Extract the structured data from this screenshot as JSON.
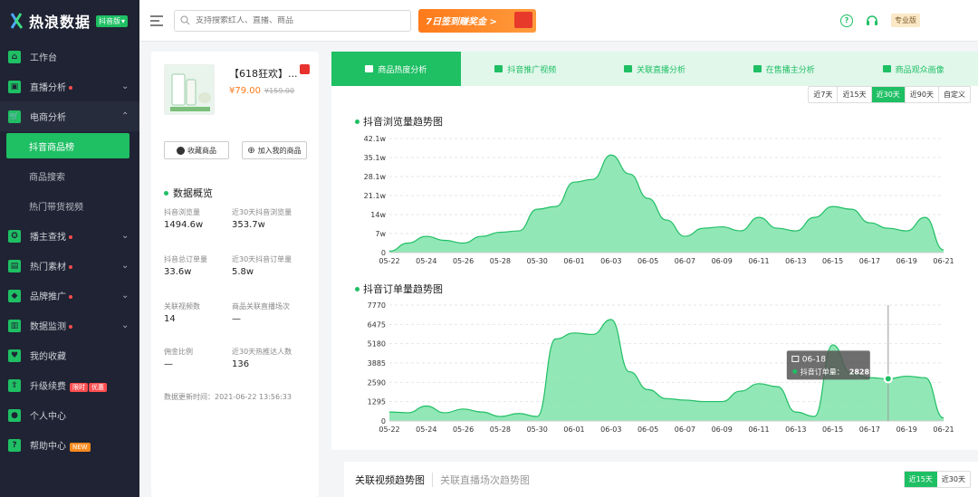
{
  "app": {
    "name": "热浪数据",
    "version_badge": "抖音版"
  },
  "sidebar": {
    "items": [
      {
        "label": "工作台",
        "icon": "home-icon"
      },
      {
        "label": "直播分析",
        "icon": "live-icon",
        "dot": true
      },
      {
        "label": "电商分析",
        "icon": "cart-icon",
        "open": true
      },
      {
        "label": "抖音商品榜",
        "sub": true,
        "active": true
      },
      {
        "label": "商品搜索",
        "sub": true
      },
      {
        "label": "热门带货视频",
        "sub": true
      },
      {
        "label": "播主查找",
        "icon": "star-icon",
        "dot": true
      },
      {
        "label": "热门素材",
        "icon": "tv-icon",
        "dot": true
      },
      {
        "label": "品牌推广",
        "icon": "cube-icon",
        "dot": true
      },
      {
        "label": "数据监测",
        "icon": "chart-icon",
        "dot": true
      },
      {
        "label": "我的收藏",
        "icon": "heart-icon"
      },
      {
        "label": "升级续费",
        "icon": "upgrade-icon",
        "tag1": "限时",
        "tag2": "优惠"
      },
      {
        "label": "个人中心",
        "icon": "user-icon"
      },
      {
        "label": "帮助中心",
        "icon": "help-icon",
        "tagnew": "NEW"
      }
    ]
  },
  "topbar": {
    "search_placeholder": "支持搜索红人、直播、商品",
    "promo": "7日签到赚奖金 >",
    "pro": "专业版"
  },
  "product": {
    "title": "【618狂欢】...",
    "price": "¥79.00",
    "old_price": "¥159.00",
    "collect": "收藏商品",
    "add": "加入我的商品"
  },
  "overview": {
    "title": "数据概览",
    "stats": [
      {
        "label": "抖音浏览量",
        "value": "1494.6w"
      },
      {
        "label": "近30天抖音浏览量",
        "value": "353.7w"
      },
      {
        "label": "抖音总订单量",
        "value": "33.6w"
      },
      {
        "label": "近30天抖音订单量",
        "value": "5.8w"
      },
      {
        "label": "关联视频数",
        "value": "14"
      },
      {
        "label": "商品关联直播场次",
        "value": "—"
      },
      {
        "label": "佣金比例",
        "value": "—"
      },
      {
        "label": "近30天热推达人数",
        "value": "136"
      }
    ],
    "updated": "数据更新时间：2021-06-22 13:56:33"
  },
  "tabs": [
    {
      "label": "商品热度分析",
      "icon": "bag-icon",
      "active": true
    },
    {
      "label": "抖音推广视频",
      "icon": "video-icon"
    },
    {
      "label": "关联直播分析",
      "icon": "link-icon"
    },
    {
      "label": "在售播主分析",
      "icon": "person-icon"
    },
    {
      "label": "商品观众画像",
      "icon": "portrait-icon"
    }
  ],
  "range": [
    "近7天",
    "近15天",
    "近30天",
    "近90天",
    "自定义"
  ],
  "range_active": "近30天",
  "bottom": {
    "t1": "关联视频趋势图",
    "t2": "关联直播场次趋势图",
    "r1": "近15天",
    "r2": "近30天"
  },
  "tooltip": {
    "date": "06-18",
    "label": "抖音订单量：",
    "value": "2828"
  },
  "colors": {
    "accent": "#1fbf64",
    "fill": "#7fe3aa"
  },
  "chart_data": [
    {
      "type": "area",
      "title": "抖音浏览量趋势图",
      "x": [
        "05-22",
        "05-23",
        "05-24",
        "05-25",
        "05-26",
        "05-27",
        "05-28",
        "05-29",
        "05-30",
        "05-31",
        "06-01",
        "06-02",
        "06-03",
        "06-04",
        "06-05",
        "06-06",
        "06-07",
        "06-08",
        "06-09",
        "06-10",
        "06-11",
        "06-12",
        "06-13",
        "06-14",
        "06-15",
        "06-16",
        "06-17",
        "06-18",
        "06-19",
        "06-20",
        "06-21"
      ],
      "xticks": [
        "05-22",
        "05-24",
        "05-26",
        "05-28",
        "05-30",
        "06-01",
        "06-03",
        "06-05",
        "06-07",
        "06-09",
        "06-11",
        "06-13",
        "06-15",
        "06-17",
        "06-19",
        "06-21"
      ],
      "yticks": [
        "0",
        "7w",
        "14w",
        "21.1w",
        "28.1w",
        "35.1w",
        "42.1w"
      ],
      "ylim": [
        0,
        42.1
      ],
      "values": [
        0.5,
        3.5,
        6,
        4.5,
        3.5,
        6,
        7.5,
        8,
        16,
        17,
        26,
        27,
        36,
        29,
        20,
        12,
        6,
        9,
        9.5,
        8,
        13,
        9,
        8,
        13,
        17,
        16,
        11,
        9,
        8,
        13,
        1
      ]
    },
    {
      "type": "area",
      "title": "抖音订单量趋势图",
      "x": [
        "05-22",
        "05-23",
        "05-24",
        "05-25",
        "05-26",
        "05-27",
        "05-28",
        "05-29",
        "05-30",
        "05-31",
        "06-01",
        "06-02",
        "06-03",
        "06-04",
        "06-05",
        "06-06",
        "06-07",
        "06-08",
        "06-09",
        "06-10",
        "06-11",
        "06-12",
        "06-13",
        "06-14",
        "06-15",
        "06-16",
        "06-17",
        "06-18",
        "06-19",
        "06-20",
        "06-21"
      ],
      "xticks": [
        "05-22",
        "05-24",
        "05-26",
        "05-28",
        "05-30",
        "06-01",
        "06-03",
        "06-05",
        "06-07",
        "06-09",
        "06-11",
        "06-13",
        "06-15",
        "06-17",
        "06-19",
        "06-21"
      ],
      "yticks": [
        "0",
        "1295",
        "2590",
        "3885",
        "5180",
        "6475",
        "7770"
      ],
      "ylim": [
        0,
        7770
      ],
      "values": [
        600,
        550,
        1000,
        550,
        800,
        600,
        300,
        500,
        300,
        5500,
        5900,
        5800,
        6800,
        3300,
        2100,
        1500,
        1400,
        1300,
        1300,
        2000,
        2500,
        2300,
        600,
        300,
        5100,
        3200,
        2900,
        2828,
        3000,
        2900,
        200
      ]
    }
  ]
}
